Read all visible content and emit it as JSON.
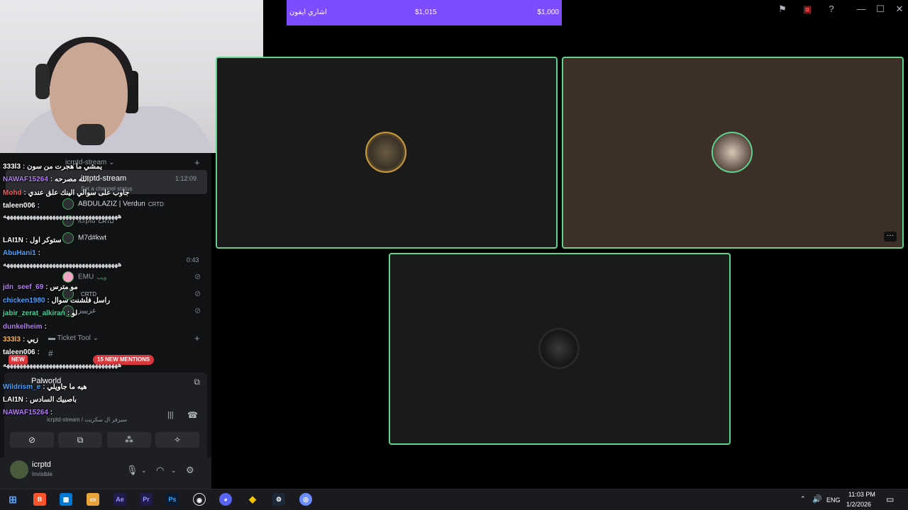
{
  "donation": {
    "name": "اشاري ايفون",
    "raised": "$1,015",
    "goal": "$1,000"
  },
  "sidebar": {
    "server_channel": "icrptd-stream",
    "voice_channel": {
      "name": "icrptd-stream",
      "duration": "1:12:09",
      "status": "Set a channel status",
      "members": [
        {
          "name": "ABDULAZIZ | Verdun",
          "badge": "CRTD"
        },
        {
          "name": "icrptd",
          "badge": "CRTD"
        },
        {
          "name": "M7d#kwt",
          "badge": ""
        },
        {
          "name": "EMU",
          "badge": "ويب"
        },
        {
          "name": "",
          "badge": "CRTD"
        },
        {
          "name": "عزيييز",
          "badge": ""
        }
      ],
      "timer_2": "0:43"
    },
    "category": "Ticket Tool",
    "new_badge": "NEW",
    "mentions": "15 NEW MENTIONS",
    "activity": {
      "game": "Palworld"
    },
    "voice_connected": "icrptd-stream / سيرفر ال سكريت",
    "user": {
      "name": "icrptd",
      "status": "Invisible"
    }
  },
  "chat": [
    {
      "name": "333l3",
      "msg": "يمشي ما هجرت من سون",
      "color": "#ffffff"
    },
    {
      "name": "NAWAF15264",
      "msg": "الله مصرحه",
      "color": "#b57bff"
    },
    {
      "name": "Mohd",
      "msg": "جاوب على سوالي الينك علق عندي",
      "color": "#ff5a5a"
    },
    {
      "name": "taleen006",
      "msg": "هههههههههههههههههههههههههههههههههههه",
      "color": "#ffffff"
    },
    {
      "name": "LAI1N",
      "msg": "ستوكر اول",
      "color": "#ffffff"
    },
    {
      "name": "AbuHani1",
      "msg": "",
      "color": "#4aa3ff"
    },
    {
      "name": "jdn_seef_69",
      "msg": "مو مترس",
      "color": "#b57bff"
    },
    {
      "name": "chicken1980",
      "msg": "راسل فلشنت سوال",
      "color": "#4aa3ff"
    },
    {
      "name": "jabir_zerat_alkiran",
      "msg": "لو",
      "color": "#4ad3a3"
    },
    {
      "name": "dunkelheim",
      "msg": "",
      "color": "#b57bff"
    },
    {
      "name": "333l3",
      "msg": "زيي",
      "color": "#ffb84a"
    },
    {
      "name": "taleen006",
      "msg": "هههههههههههههههههههههههههههههههههههه",
      "color": "#ffffff"
    },
    {
      "name": "Wildrism_e",
      "msg": "هيه ما جاويلي",
      "color": "#4aa3ff"
    },
    {
      "name": "LAI1N",
      "msg": "باصبيك السادس",
      "color": "#ffffff"
    },
    {
      "name": "NAWAF15264",
      "msg": "",
      "color": "#b57bff"
    }
  ],
  "taskbar": {
    "lang": "ENG",
    "time": "11:03 PM",
    "date": "1/2/2026"
  },
  "colors": {
    "accent": "#5fd38d",
    "donation_bar": "#7c4dff",
    "mention": "#da373c"
  }
}
